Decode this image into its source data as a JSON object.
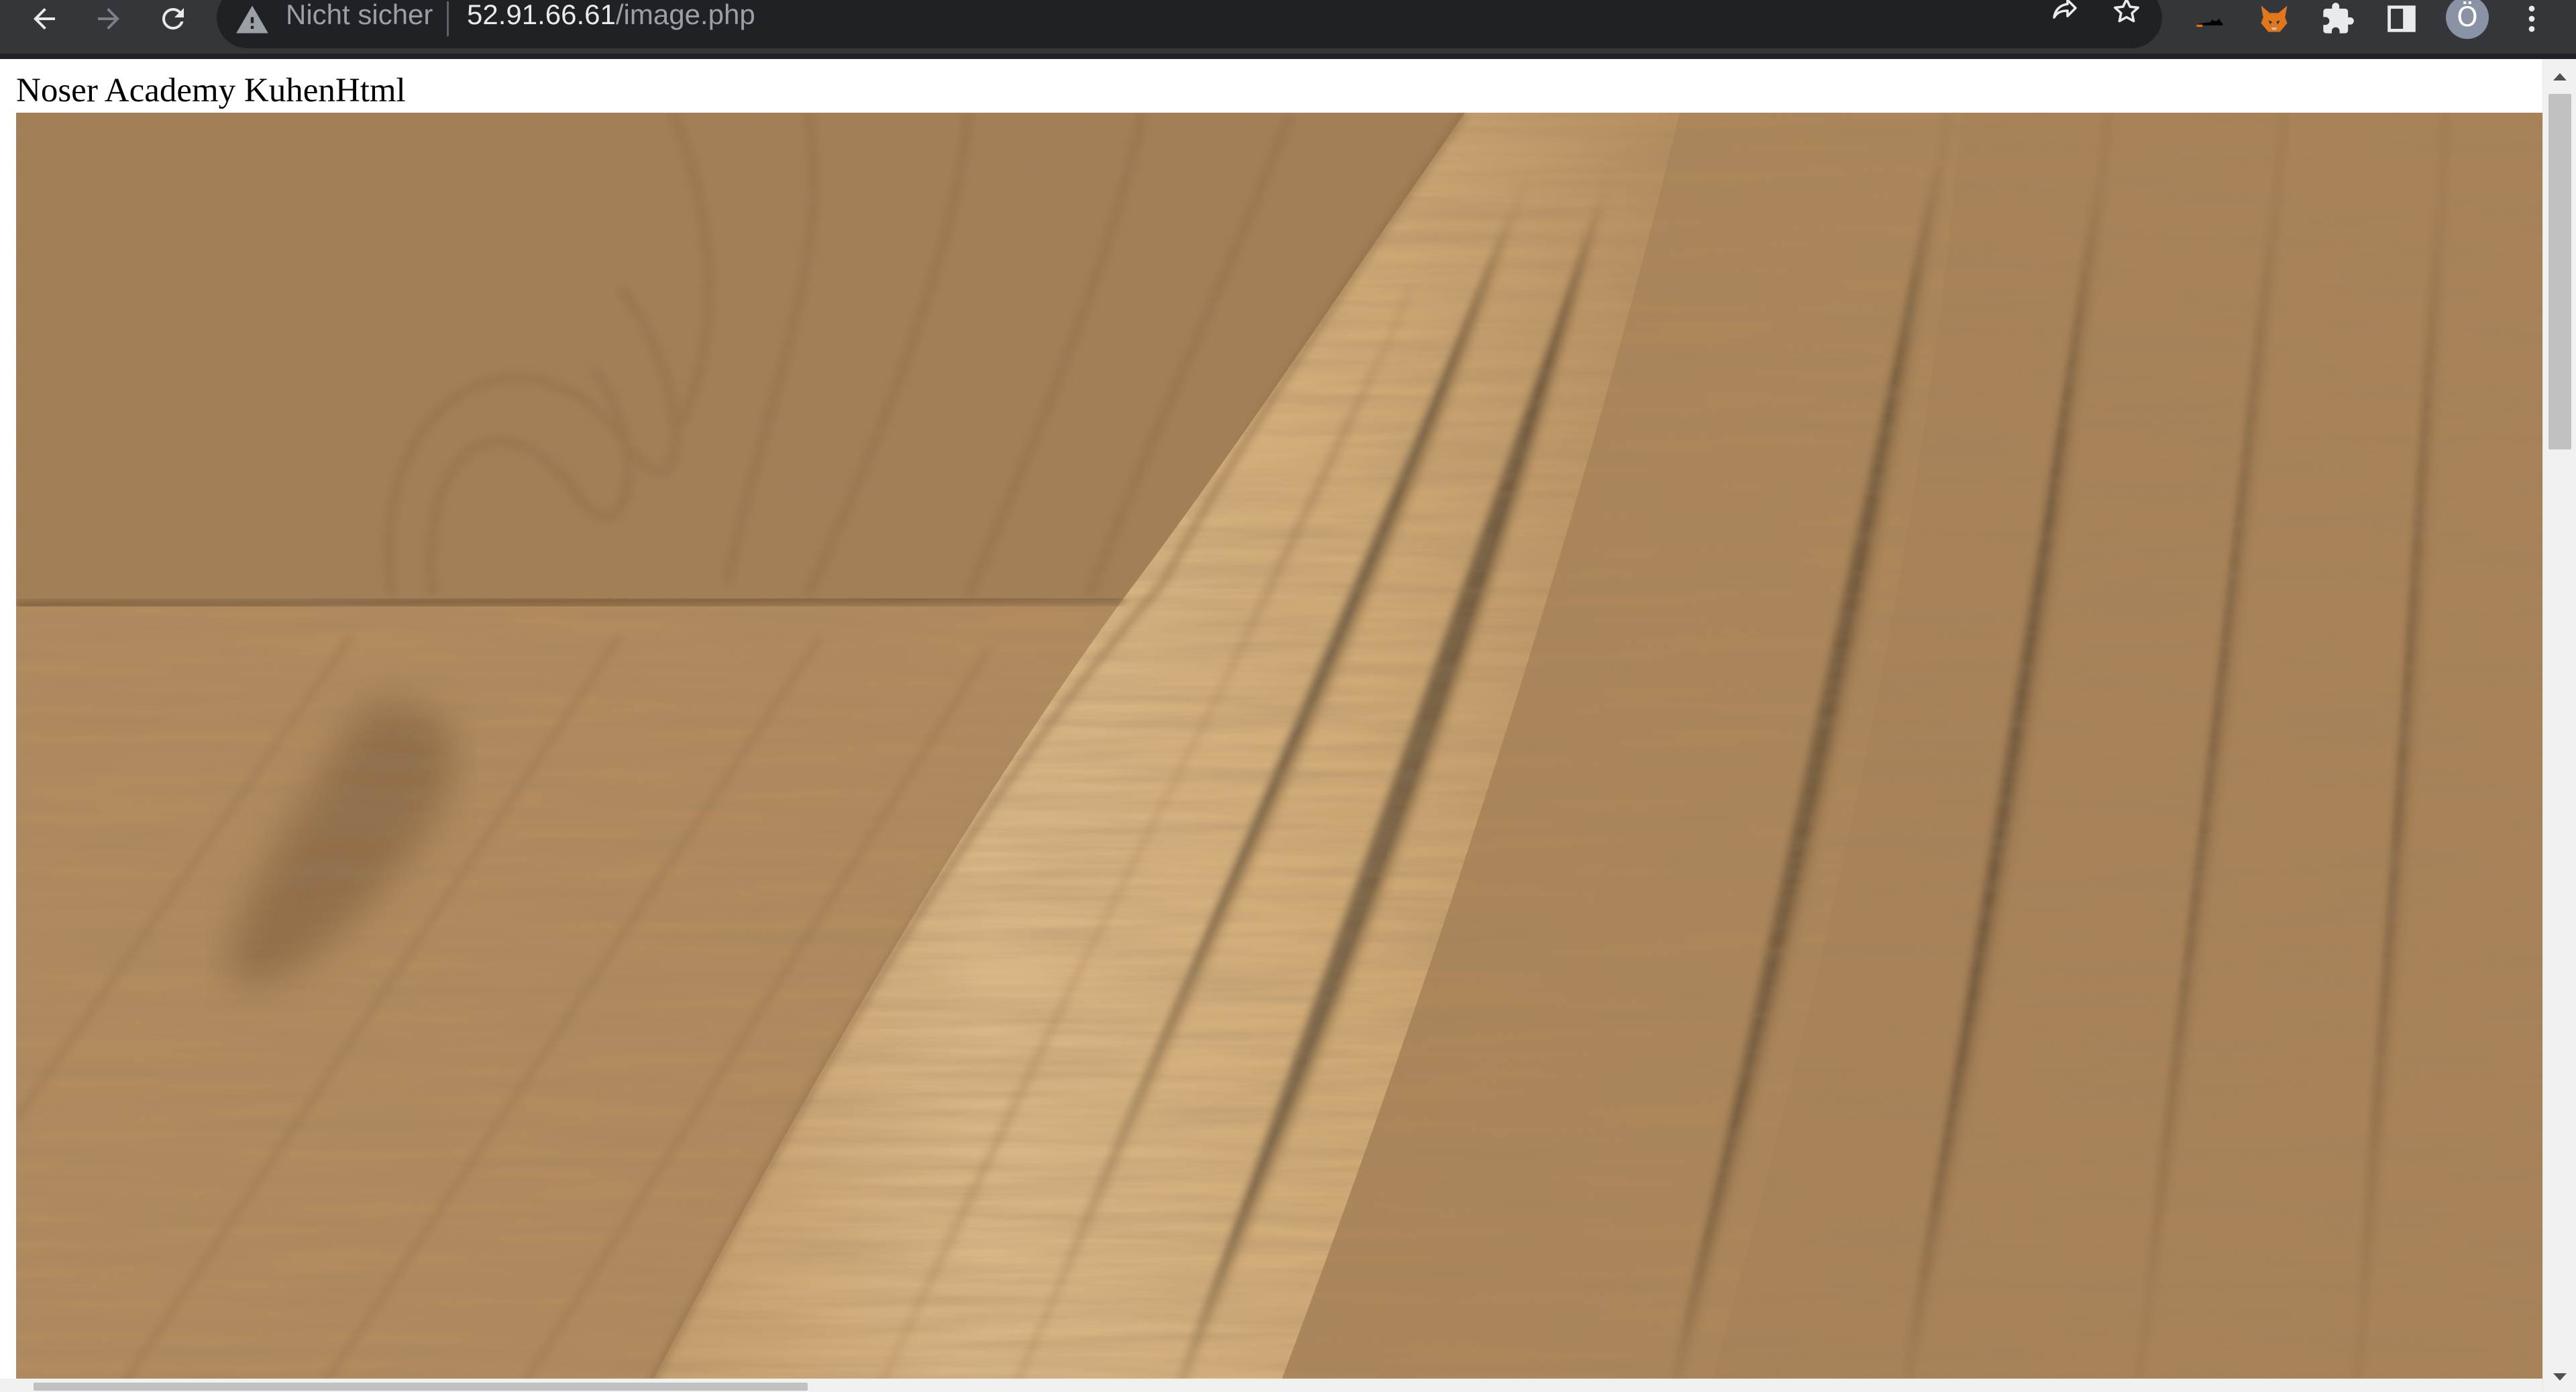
{
  "browser": {
    "security_status": "Nicht sicher",
    "url_host": "52.91.66.61",
    "url_path": "/image.php",
    "profile_initial": "Ö"
  },
  "icons": {
    "back": "arrow-left-icon",
    "forward": "arrow-right-icon",
    "reload": "reload-icon",
    "security": "warning-triangle-icon",
    "share": "share-icon",
    "bookmark": "star-icon",
    "extension_1": "cat-extension-icon",
    "extension_2": "fox-extension-icon",
    "extensions": "puzzle-icon",
    "side_panel": "side-panel-icon",
    "menu": "kebab-menu-icon"
  },
  "colors": {
    "toolbar": "#35363a",
    "omnibox": "#202124",
    "url_host": "#e8eaed",
    "url_path": "#9aa0a6",
    "wood_base": "#a98359"
  },
  "page": {
    "heading": "Noser Academy KuhenHtml"
  }
}
